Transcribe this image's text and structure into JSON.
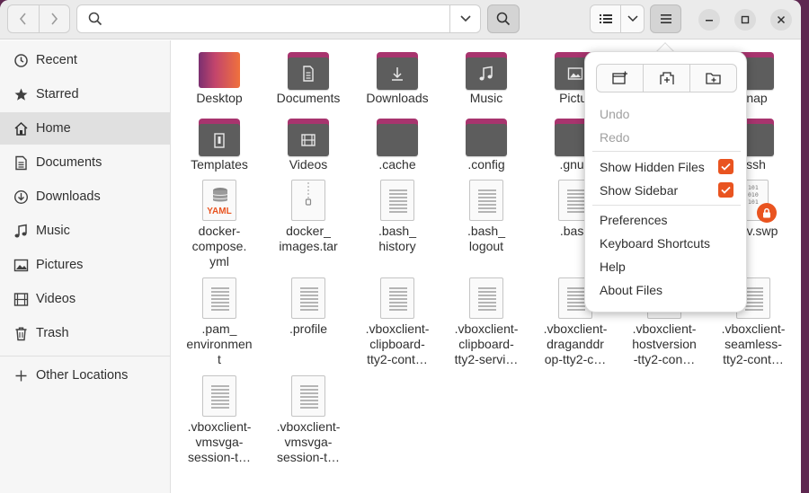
{
  "colors": {
    "accent": "#e95420",
    "folder_tab": "#a8346e",
    "folder_body": "#5d5d5d",
    "sidebar_bg": "#f6f6f6",
    "desktop_background": "#5e2750"
  },
  "sidebar": {
    "items": [
      {
        "label": "Recent",
        "icon": "clock-icon"
      },
      {
        "label": "Starred",
        "icon": "star-icon"
      },
      {
        "label": "Home",
        "icon": "home-icon",
        "active": true
      },
      {
        "label": "Documents",
        "icon": "document-icon"
      },
      {
        "label": "Downloads",
        "icon": "download-icon"
      },
      {
        "label": "Music",
        "icon": "music-icon"
      },
      {
        "label": "Pictures",
        "icon": "picture-icon"
      },
      {
        "label": "Videos",
        "icon": "video-icon"
      },
      {
        "label": "Trash",
        "icon": "trash-icon"
      }
    ],
    "other_locations": {
      "label": "Other Locations",
      "icon": "plus-icon"
    }
  },
  "files": [
    {
      "name": "Desktop",
      "type": "desktop-folder"
    },
    {
      "name": "Documents",
      "type": "folder",
      "emblem": "document-icon"
    },
    {
      "name": "Downloads",
      "type": "folder",
      "emblem": "download-icon"
    },
    {
      "name": "Music",
      "type": "folder",
      "emblem": "music-icon"
    },
    {
      "name": "Pictur",
      "type": "folder",
      "emblem": "picture-icon"
    },
    {
      "name": "nap",
      "type": "folder"
    },
    {
      "name": "Templates",
      "type": "folder",
      "emblem": "template-icon"
    },
    {
      "name": "Videos",
      "type": "folder",
      "emblem": "video-icon"
    },
    {
      "name": ".cache",
      "type": "folder"
    },
    {
      "name": ".config",
      "type": "folder"
    },
    {
      "name": ".gnup",
      "type": "folder"
    },
    {
      "name": "ssh",
      "type": "folder"
    },
    {
      "name": "docker-\ncompose.\nyml",
      "type": "yaml"
    },
    {
      "name": "docker_\nimages.tar",
      "type": "archive"
    },
    {
      "name": ".bash_\nhistory",
      "type": "text"
    },
    {
      "name": ".bash_\nlogout",
      "type": "text"
    },
    {
      "name": ".bash",
      "type": "text"
    },
    {
      "name": "v.swp",
      "type": "binary-locked"
    },
    {
      "name": ".pam_\nenvironmen\nt",
      "type": "text"
    },
    {
      "name": ".profile",
      "type": "text"
    },
    {
      "name": ".vboxclient-\nclipboard-\ntty2-cont…",
      "type": "text"
    },
    {
      "name": ".vboxclient-\nclipboard-\ntty2-servi…",
      "type": "text"
    },
    {
      "name": ".vboxclient-\ndraganddr\nop-tty2-c…",
      "type": "text"
    },
    {
      "name": ".vboxclient-\nhostversion\n-tty2-con…",
      "type": "text"
    },
    {
      "name": ".vboxclient-\nseamless-\ntty2-cont…",
      "type": "text"
    },
    {
      "name": ".vboxclient-\nvmsvga-\nsession-t…",
      "type": "text"
    },
    {
      "name": ".vboxclient-\nvmsvga-\nsession-t…",
      "type": "text"
    }
  ],
  "yaml_badge": "YAML",
  "binary_digits": "101\n010\n101",
  "menu": {
    "buttons": [
      "new-window-icon",
      "new-tab-icon",
      "new-folder-icon"
    ],
    "undo": "Undo",
    "redo": "Redo",
    "show_hidden": "Show Hidden Files",
    "show_hidden_checked": true,
    "show_sidebar": "Show Sidebar",
    "show_sidebar_checked": true,
    "preferences": "Preferences",
    "shortcuts": "Keyboard Shortcuts",
    "help": "Help",
    "about": "About Files"
  }
}
